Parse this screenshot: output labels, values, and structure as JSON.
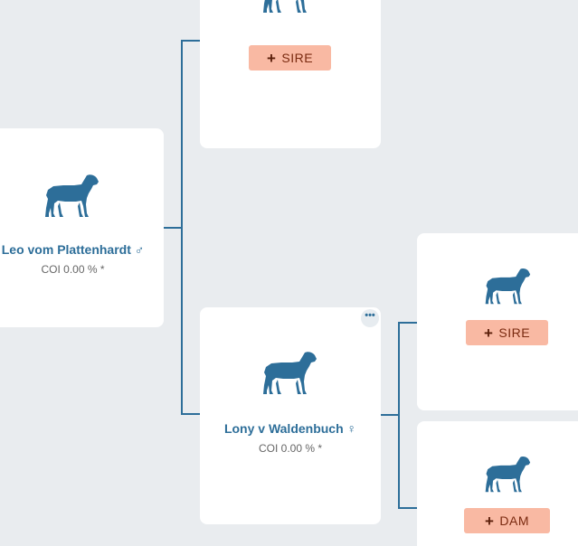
{
  "colors": {
    "background": "#e9ecef",
    "card": "#ffffff",
    "accent": "#2d6e99",
    "add_button": "#f9b9a3",
    "add_button_text": "#7a2a10"
  },
  "icons": {
    "dog": "dog-silhouette-icon",
    "add": "plus-icon",
    "menu": "more-horizontal-icon",
    "male": "male-symbol-icon",
    "female": "female-symbol-icon"
  },
  "subject": {
    "name": "Leo vom Plattenhardt",
    "sex_symbol": "♂",
    "coi": "COI 0.00 % *"
  },
  "parents": {
    "sire_empty": {
      "add_label": "SIRE"
    },
    "dam": {
      "name": "Lony v Waldenbuch",
      "sex_symbol": "♀",
      "coi": "COI 0.00 % *",
      "menu": "•••"
    }
  },
  "grandparents": {
    "dam_sire_empty": {
      "add_label": "SIRE"
    },
    "dam_dam_empty": {
      "add_label": "DAM"
    }
  }
}
